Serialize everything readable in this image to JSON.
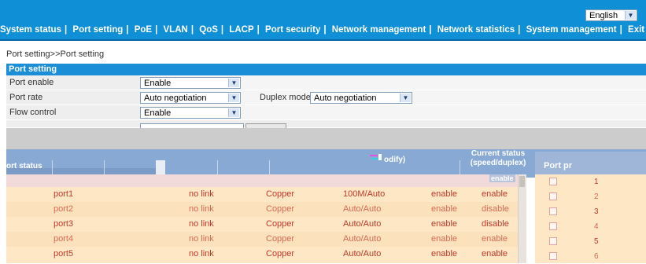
{
  "header": {
    "language": "English",
    "nav": [
      "System status",
      "Port setting",
      "PoE",
      "VLAN",
      "QoS",
      "LACP",
      "Port security",
      "Network management",
      "Network statistics",
      "System management",
      "Exit"
    ]
  },
  "breadcrumb": "Port setting>>Port setting",
  "section_title": "Port setting",
  "form": {
    "port_enable": {
      "label": "Port enable",
      "value": "Enable"
    },
    "port_rate": {
      "label": "Port rate",
      "value": "Auto negotiation"
    },
    "duplex_mode": {
      "label": "Duplex mode",
      "value": "Auto negotiation"
    },
    "flow_control": {
      "label": "Flow control",
      "value": "Enable"
    }
  },
  "table": {
    "header_fragments": {
      "port_status": "ort status",
      "modify": "odify)",
      "current_status": "Current status\n(speed/duplex)",
      "port_pr": "Port pr",
      "enable_badge": "enable"
    },
    "rows": [
      {
        "port": "port1",
        "link": "no link",
        "media": "Copper",
        "rate": "100M/Auto",
        "enable": "enable",
        "status": "enable",
        "num": "1"
      },
      {
        "port": "port2",
        "link": "no link",
        "media": "Copper",
        "rate": "Auto/Auto",
        "enable": "enable",
        "status": "disable",
        "num": "2"
      },
      {
        "port": "port3",
        "link": "no link",
        "media": "Copper",
        "rate": "Auto/Auto",
        "enable": "enable",
        "status": "disable",
        "num": "3"
      },
      {
        "port": "port4",
        "link": "no link",
        "media": "Copper",
        "rate": "Auto/Auto",
        "enable": "enable",
        "status": "enable",
        "num": "4"
      },
      {
        "port": "port5",
        "link": "no link",
        "media": "Copper",
        "rate": "Auto/Auto",
        "enable": "enable",
        "status": "enable",
        "num": "5"
      }
    ],
    "next_num": "6"
  },
  "colors": {
    "brand": "#0f8fd6",
    "section": "#1a8fd8",
    "row_bg": "#fde7c5",
    "text_red": "#c0392b"
  }
}
